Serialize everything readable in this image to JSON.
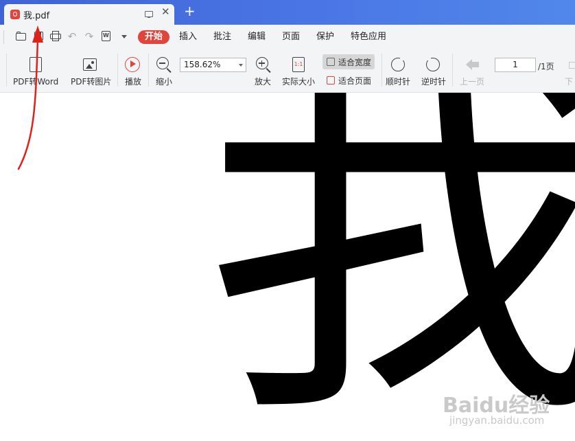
{
  "tab": {
    "title": "我.pdf",
    "close_glyph": "✕",
    "new_tab_glyph": "+"
  },
  "menubar": {
    "items": [
      "开始",
      "插入",
      "批注",
      "编辑",
      "页面",
      "保护",
      "特色应用"
    ],
    "active_index": 0
  },
  "ribbon": {
    "pdf_to_word": "PDF转Word",
    "pdf_to_image": "PDF转图片",
    "play": "播放",
    "zoom_out": "缩小",
    "zoom_value": "158.62%",
    "zoom_in": "放大",
    "actual_size": "实际大小",
    "actual_size_glyph": "1:1",
    "fit_width": "适合宽度",
    "fit_page": "适合页面",
    "rotate_cw": "顺时针",
    "rotate_ccw": "逆时针",
    "prev_page": "上一页",
    "page_current": "1",
    "page_total": "/1页",
    "next_page": "下一"
  },
  "document": {
    "glyph": "我"
  },
  "watermark": {
    "brand": "Baidu经验",
    "url": "jingyan.baidu.com"
  },
  "colors": {
    "accent": "#e0443a",
    "titlebar": "#4a76e5",
    "annotation": "#e0201a"
  }
}
